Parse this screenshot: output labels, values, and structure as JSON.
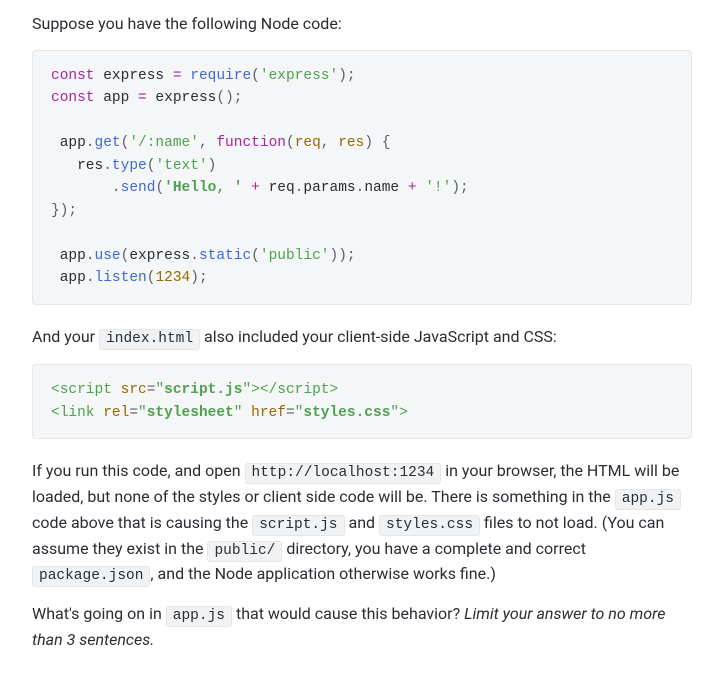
{
  "intro": "Suppose you have the following Node code:",
  "code1": {
    "l1": {
      "const": "const",
      "sp1": " express ",
      "eq": "=",
      "sp2": " ",
      "require": "require",
      "lp": "(",
      "qexpress": "'express'",
      "rp": ")",
      "semi": ";"
    },
    "l2": {
      "const": "const",
      "sp1": " app ",
      "eq": "=",
      "sp2": " express",
      "lp": "(",
      "rp": ")",
      "semi": ";"
    },
    "l3": "",
    "l4": {
      "pre": " app",
      "dot1": ".",
      "get": "get",
      "lp": "(",
      "route": "'/:name'",
      "comma": ",",
      "sp": " ",
      "func": "function",
      "lp2": "(",
      "req": "req",
      "comma2": ", ",
      "res": "res",
      "rp2": ")",
      "sp2": " ",
      "brace": "{"
    },
    "l5": {
      "pre": "   res",
      "dot1": ".",
      "type": "type",
      "lp": "(",
      "text": "'text'",
      "rp": ")"
    },
    "l6": {
      "pre": "       ",
      "dot1": ".",
      "send": "send",
      "lp": "(",
      "hello": "'Hello, '",
      "sp1": " ",
      "plus1": "+",
      "sp2": " req",
      "dot2": ".",
      "params": "params",
      "dot3": ".",
      "name": "name ",
      "plus2": "+",
      "sp3": " ",
      "bang": "'!'",
      "rp": ")",
      "semi": ";"
    },
    "l7": {
      "rbrace": "}",
      "rp": ")",
      "semi": ";"
    },
    "l8": "",
    "l9": {
      "pre": " app",
      "dot1": ".",
      "use": "use",
      "lp": "(",
      "express": "express",
      "dot2": ".",
      "static": "static",
      "lp2": "(",
      "public": "'public'",
      "rp2": ")",
      "rp": ")",
      "semi": ";"
    },
    "l10": {
      "pre": " app",
      "dot1": ".",
      "listen": "listen",
      "lp": "(",
      "port": "1234",
      "rp": ")",
      "semi": ";"
    }
  },
  "para2": {
    "a": "And your ",
    "b": "index.html",
    "c": " also included your client-side JavaScript and CSS:"
  },
  "code2": {
    "l1": {
      "lt": "<",
      "tag": "script",
      "sp": " ",
      "attr": "src",
      "eq": "=",
      "q1": "\"",
      "val": "script.js",
      "q2": "\"",
      "gt": ">",
      "lt2": "</",
      "tag2": "script",
      "gt2": ">"
    },
    "l2": {
      "lt": "<",
      "tag": "link",
      "sp": " ",
      "attr1": "rel",
      "eq1": "=",
      "q1": "\"",
      "val1": "stylesheet",
      "q2": "\"",
      "sp2": " ",
      "attr2": "href",
      "eq2": "=",
      "q3": "\"",
      "val2": "styles.css",
      "q4": "\"",
      "gt": ">"
    }
  },
  "para3": {
    "a": "If you run this code, and open ",
    "b": "http://localhost:1234",
    "c": " in your browser, the HTML will be loaded, but none of the styles or client side code will be. There is something in the ",
    "d": "app.js",
    "e": " code above that is causing the ",
    "f": "script.js",
    "g": " and ",
    "h": "styles.css",
    "i": " files to not load. (You can assume they exist in the ",
    "j": "public/",
    "k": " directory, you have a complete and correct ",
    "l": "package.json",
    "m": ", and the Node application otherwise works fine.)"
  },
  "para4": {
    "a": "What's going on in ",
    "b": "app.js",
    "c": " that would cause this behavior? ",
    "d": "Limit your answer to no more than 3 sentences."
  }
}
